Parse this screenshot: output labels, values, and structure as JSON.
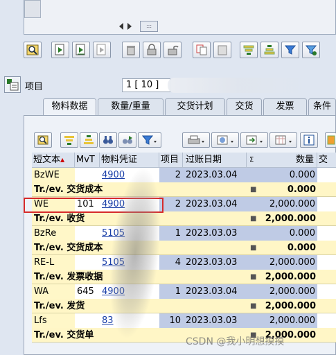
{
  "navigator": {
    "grip_label": ":::"
  },
  "item_row": {
    "label": "项目",
    "value": "1 [ 10 ]"
  },
  "tabs": [
    {
      "label": "物料数据"
    },
    {
      "label": "数量/重量"
    },
    {
      "label": "交货计划"
    },
    {
      "label": "交货"
    },
    {
      "label": "发票"
    },
    {
      "label": "条件"
    }
  ],
  "table": {
    "headers": {
      "text": "短文本",
      "mvt": "MvT",
      "doc": "物料凭证",
      "item": "项目",
      "date": "过账日期",
      "sigma": "Σ",
      "qty": "数量",
      "jiao": "交"
    },
    "rows": [
      {
        "kind": "data",
        "text": "BzWE",
        "mvt": "",
        "doc": "4900",
        "item": "2",
        "date": "2023.03.04",
        "qty": "0.000"
      },
      {
        "kind": "total",
        "label": "Tr./ev. 交货成本",
        "value": "0.000"
      },
      {
        "kind": "data",
        "text": "WE",
        "mvt": "101",
        "doc": "4900",
        "item": "2",
        "date": "2023.03.04",
        "qty": "2,000.000"
      },
      {
        "kind": "total",
        "label": "Tr./ev. 收货",
        "value": "2,000.000"
      },
      {
        "kind": "data",
        "text": "BzRe",
        "mvt": "",
        "doc": "5105",
        "item": "1",
        "date": "2023.03.03",
        "qty": "0.000"
      },
      {
        "kind": "total",
        "label": "Tr./ev. 交货成本",
        "value": "0.000"
      },
      {
        "kind": "data",
        "text": "RE-L",
        "mvt": "",
        "doc": "5105",
        "item": "4",
        "date": "2023.03.03",
        "qty": "2,000.000"
      },
      {
        "kind": "total",
        "label": "Tr./ev. 发票收据",
        "value": "2,000.000"
      },
      {
        "kind": "data",
        "text": "WA",
        "mvt": "645",
        "doc": "4900",
        "item": "1",
        "date": "2023.03.04",
        "qty": "2,000.000"
      },
      {
        "kind": "total",
        "label": "Tr./ev. 发货",
        "value": "2,000.000"
      },
      {
        "kind": "data",
        "text": "Lfs",
        "mvt": "",
        "doc": "83",
        "item": "10",
        "date": "2023.03.03",
        "qty": "2,000.000"
      },
      {
        "kind": "total",
        "label": "Tr./ev. 交货单",
        "value": "2,000.000"
      }
    ]
  },
  "watermark": "CSDN @我小明想摸摸",
  "colors": {
    "accent_red": "#d62a2a",
    "link_blue": "#1a3fa8",
    "total_yellow": "#fff6c6",
    "cell_blue": "#bfcbe5"
  }
}
